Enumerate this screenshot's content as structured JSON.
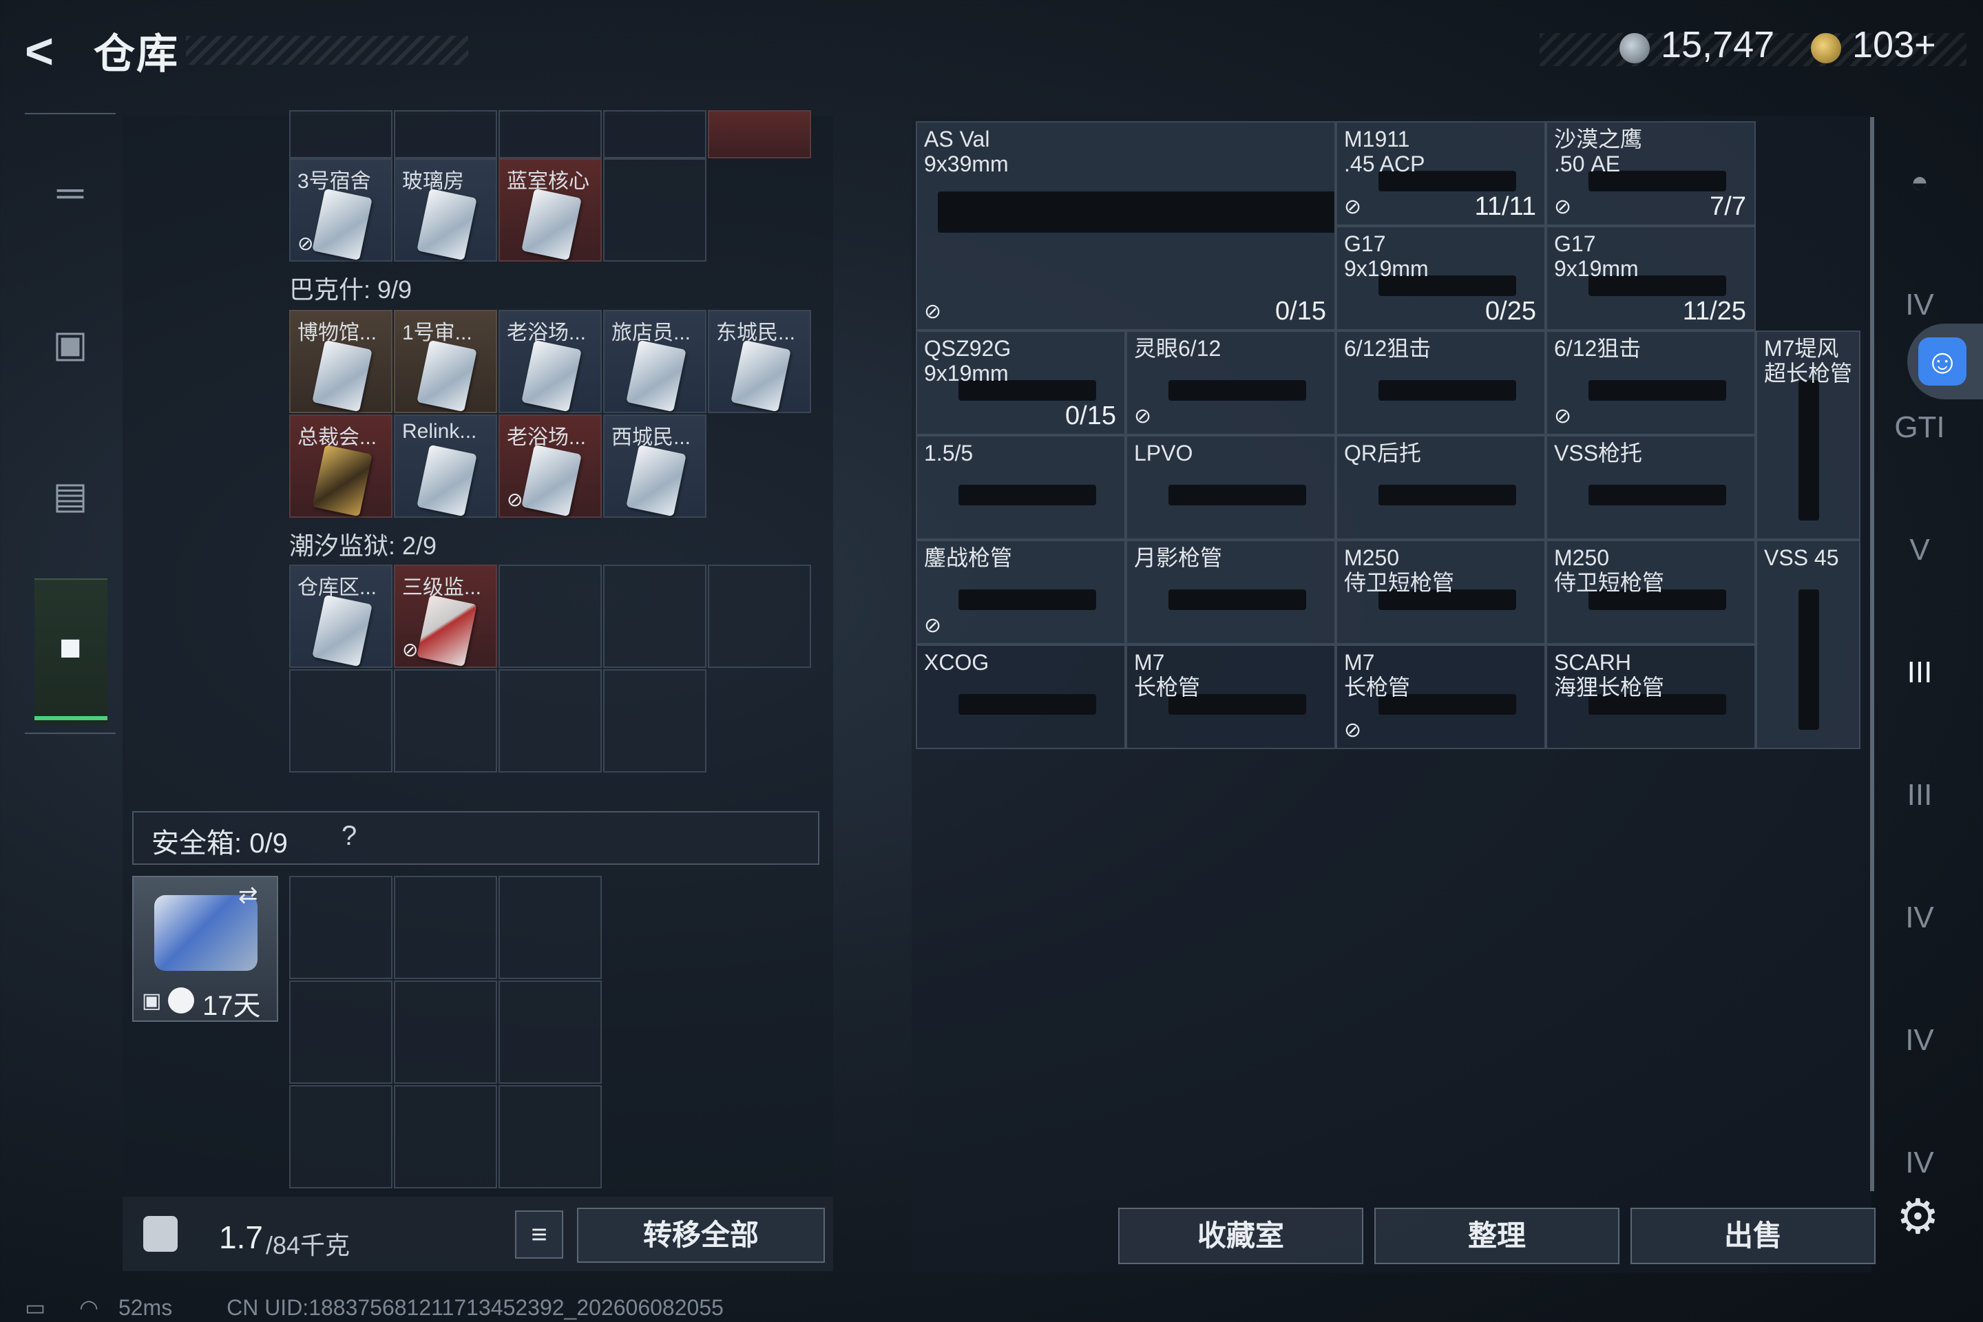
{
  "header": {
    "title": "仓库",
    "currency1": "15,747",
    "currency2": "103+"
  },
  "left_rail": [
    "gun-icon",
    "backpack-icon",
    "vest-icon",
    "case-icon"
  ],
  "stash": {
    "row_top": [
      {
        "label": "3号宿舍",
        "style": "blue",
        "flag": true
      },
      {
        "label": "玻璃房",
        "style": "blue",
        "flag": false
      },
      {
        "label": "蓝室核心",
        "style": "red",
        "flag": false
      }
    ],
    "section1": "巴克什: 9/9",
    "grid1": [
      {
        "label": "博物馆...",
        "style": "tan",
        "flag": false
      },
      {
        "label": "1号审...",
        "style": "tan",
        "flag": false
      },
      {
        "label": "老浴场...",
        "style": "blue",
        "flag": false
      },
      {
        "label": "旅店员...",
        "style": "blue",
        "flag": false
      },
      {
        "label": "东城民...",
        "style": "blue",
        "flag": false
      },
      {
        "label": "总裁会...",
        "style": "red",
        "flag": false
      },
      {
        "label": "Relink...",
        "style": "blue",
        "flag": false
      },
      {
        "label": "老浴场...",
        "style": "red",
        "flag": true
      },
      {
        "label": "西城民...",
        "style": "blue",
        "flag": false
      }
    ],
    "section2": "潮汐监狱: 2/9",
    "grid2": [
      {
        "label": "仓库区...",
        "style": "blue",
        "flag": false
      },
      {
        "label": "三级监...",
        "style": "red",
        "flag": true
      }
    ],
    "safe_label": "安全箱: 0/9",
    "safe_help": "?",
    "safe_days": "17天",
    "weight_value": "1.7",
    "weight_max": "/84千克",
    "transfer_all": "转移全部"
  },
  "items": [
    {
      "label": "AS Val\n9x39mm",
      "count": "0/15",
      "flag": true
    },
    {
      "label": "M1911\n.45 ACP",
      "count": "11/11",
      "flag": true
    },
    {
      "label": "沙漠之鹰\n.50 AE",
      "count": "7/7",
      "flag": true
    },
    {
      "label": "G17\n9x19mm",
      "count": "0/25",
      "flag": false
    },
    {
      "label": "G17\n9x19mm",
      "count": "11/25",
      "flag": false
    },
    {
      "label": "QSZ92G\n9x19mm",
      "count": "0/15",
      "flag": false
    },
    {
      "label": "灵眼6/12",
      "count": "",
      "flag": true
    },
    {
      "label": "6/12狙击",
      "count": "",
      "flag": false
    },
    {
      "label": "6/12狙击",
      "count": "",
      "flag": true
    },
    {
      "label": "M7堤风\n超长枪管",
      "count": "",
      "flag": false
    },
    {
      "label": "1.5/5",
      "count": "",
      "flag": false
    },
    {
      "label": "LPVO",
      "count": "",
      "flag": false
    },
    {
      "label": "QR后托",
      "count": "",
      "flag": false
    },
    {
      "label": "VSS枪托",
      "count": "",
      "flag": false
    },
    {
      "label": "鏖战枪管",
      "count": "",
      "flag": true
    },
    {
      "label": "月影枪管",
      "count": "",
      "flag": false
    },
    {
      "label": "M250\n侍卫短枪管",
      "count": "",
      "flag": false
    },
    {
      "label": "M250\n侍卫短枪管",
      "count": "",
      "flag": false
    },
    {
      "label": "VSS 45",
      "count": "",
      "flag": false
    },
    {
      "label": "XCOG",
      "count": "",
      "flag": false
    },
    {
      "label": "M7\n长枪管",
      "count": "",
      "flag": false
    },
    {
      "label": "M7\n长枪管",
      "count": "",
      "flag": true
    },
    {
      "label": "SCARH\n海狸长枪管",
      "count": "",
      "flag": false
    }
  ],
  "right_rail": [
    "helmet-icon",
    "IV",
    "GTI",
    "V",
    "III",
    "III",
    "IV",
    "IV",
    "IV"
  ],
  "bottom_buttons": {
    "collection": "收藏室",
    "sort": "整理",
    "sell": "出售"
  },
  "status": {
    "ping": "52ms",
    "uid": "CN UID:18837568121171345239​2_202606082055"
  },
  "colors": {
    "accent_green": "#4bd07a",
    "access_blue": "#3d86f0",
    "red_item": "#5a2a2a"
  }
}
